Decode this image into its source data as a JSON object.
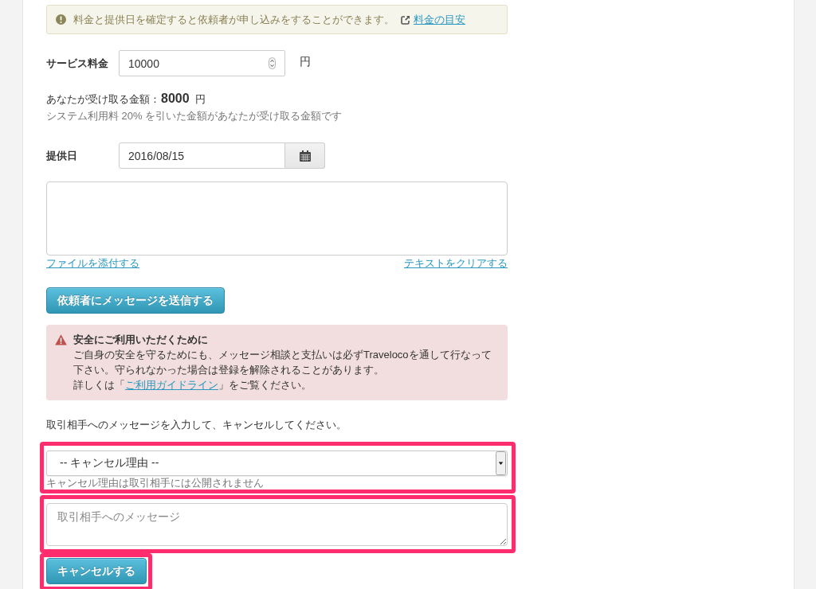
{
  "notice": {
    "text": "料金と提供日を確定すると依頼者が申し込みをすることができます。",
    "link": "料金の目安"
  },
  "service_fee": {
    "label": "サービス料金",
    "value": "10000",
    "unit": "円"
  },
  "received": {
    "label": "あなたが受け取る金額：",
    "amount": "8000",
    "unit": "円",
    "note": "システム利用料 20% を引いた金額があなたが受け取る金額です"
  },
  "service_date": {
    "label": "提供日",
    "value": "2016/08/15"
  },
  "message": {
    "attach_link": "ファイルを添付する",
    "clear_link": "テキストをクリアする"
  },
  "send_button": {
    "label": "依頼者にメッセージを送信する"
  },
  "safety_alert": {
    "title": "安全にご利用いただくために",
    "body": "ご自身の安全を守るためにも、メッセージ相談と支払いは必ずTravelocoを通して行なって下さい。守られなかった場合は登録を解除されることがあります。",
    "guide_prefix": "詳しくは「",
    "guide_link": "ご利用ガイドライン",
    "guide_suffix": "」をご覧ください。"
  },
  "cancel": {
    "instruction": "取引相手へのメッセージを入力して、キャンセルしてください。",
    "reason": {
      "value": "-- キャンセル理由 --",
      "hint": "キャンセル理由は取引相手には公開されません",
      "highlighted": true
    },
    "message": {
      "placeholder": "取引相手へのメッセージ",
      "highlighted": true
    },
    "button": {
      "label": "キャンセルする",
      "highlighted": true
    }
  }
}
